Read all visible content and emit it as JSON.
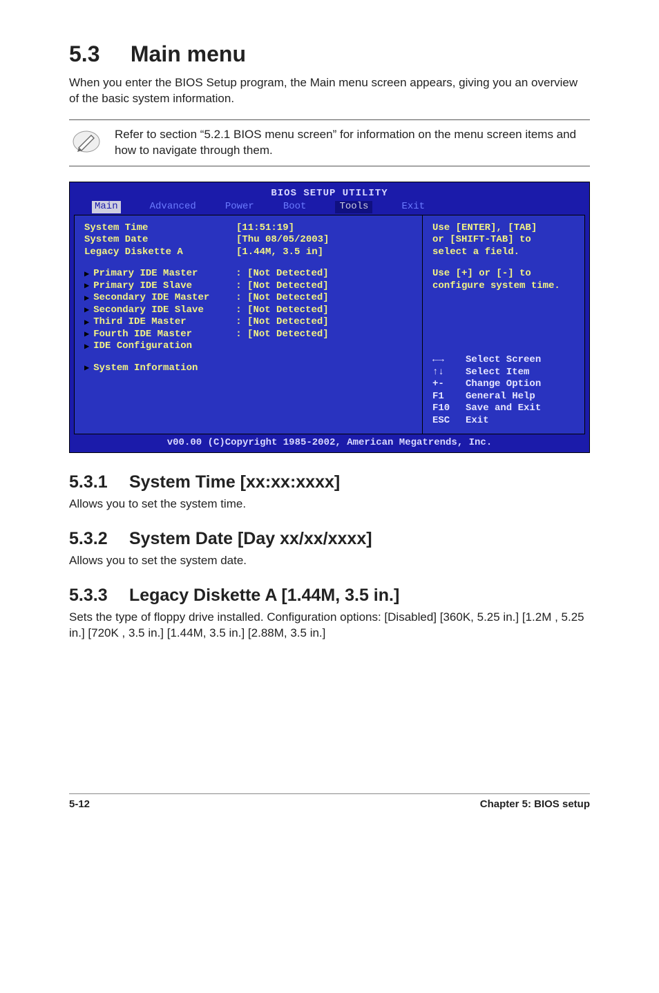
{
  "section": {
    "num": "5.3",
    "title": "Main menu"
  },
  "intro": "When you enter the BIOS Setup program, the Main menu screen appears, giving you an overview of the basic system information.",
  "note": "Refer to section “5.2.1  BIOS menu screen” for information on the menu screen items and how to navigate through them.",
  "bios": {
    "title": "BIOS SETUP UTILITY",
    "tabs": [
      "Main",
      "Advanced",
      "Power",
      "Boot",
      "Tools",
      "Exit"
    ],
    "active_tab": "Main",
    "rows": [
      {
        "label": "System Time",
        "value": "[11:51:19]"
      },
      {
        "label": "System Date",
        "value": "[Thu 08/05/2003]"
      },
      {
        "label": "Legacy Diskette A",
        "value": "[1.44M, 3.5 in]"
      }
    ],
    "submenus": [
      {
        "label": "Primary IDE Master",
        "value": ": [Not Detected]"
      },
      {
        "label": "Primary IDE Slave",
        "value": ": [Not Detected]"
      },
      {
        "label": "Secondary IDE Master",
        "value": ": [Not Detected]"
      },
      {
        "label": "Secondary IDE Slave",
        "value": ": [Not Detected]"
      },
      {
        "label": "Third IDE Master",
        "value": ": [Not Detected]"
      },
      {
        "label": "Fourth IDE Master",
        "value": ": [Not Detected]"
      },
      {
        "label": "IDE Configuration",
        "value": ""
      }
    ],
    "submenus2": [
      {
        "label": "System Information",
        "value": ""
      }
    ],
    "help1": "Use [ENTER], [TAB]",
    "help2": "or [SHIFT-TAB] to",
    "help3": "select a field.",
    "help4": "Use [+] or [-] to",
    "help5": "configure system time.",
    "nav": [
      {
        "k": "←→",
        "t": "Select Screen"
      },
      {
        "k": "↑↓",
        "t": "Select Item"
      },
      {
        "k": "+-",
        "t": "Change Option"
      },
      {
        "k": "F1",
        "t": "General Help"
      },
      {
        "k": "F10",
        "t": "Save and Exit"
      },
      {
        "k": "ESC",
        "t": "Exit"
      }
    ],
    "footer": "v00.00 (C)Copyright 1985-2002, American Megatrends, Inc."
  },
  "sub1": {
    "num": "5.3.1",
    "title": "System Time [xx:xx:xxxx]",
    "body": "Allows you to set the system time."
  },
  "sub2": {
    "num": "5.3.2",
    "title": "System Date [Day xx/xx/xxxx]",
    "body": "Allows you to set the system date."
  },
  "sub3": {
    "num": "5.3.3",
    "title": "Legacy Diskette A [1.44M, 3.5 in.]",
    "body": "Sets the type of floppy drive installed. Configuration options: [Disabled] [360K, 5.25 in.] [1.2M , 5.25 in.] [720K , 3.5 in.] [1.44M, 3.5 in.] [2.88M, 3.5 in.]"
  },
  "footer": {
    "left": "5-12",
    "right_chapter": "Chapter 5: ",
    "right_title": "BIOS setup"
  }
}
